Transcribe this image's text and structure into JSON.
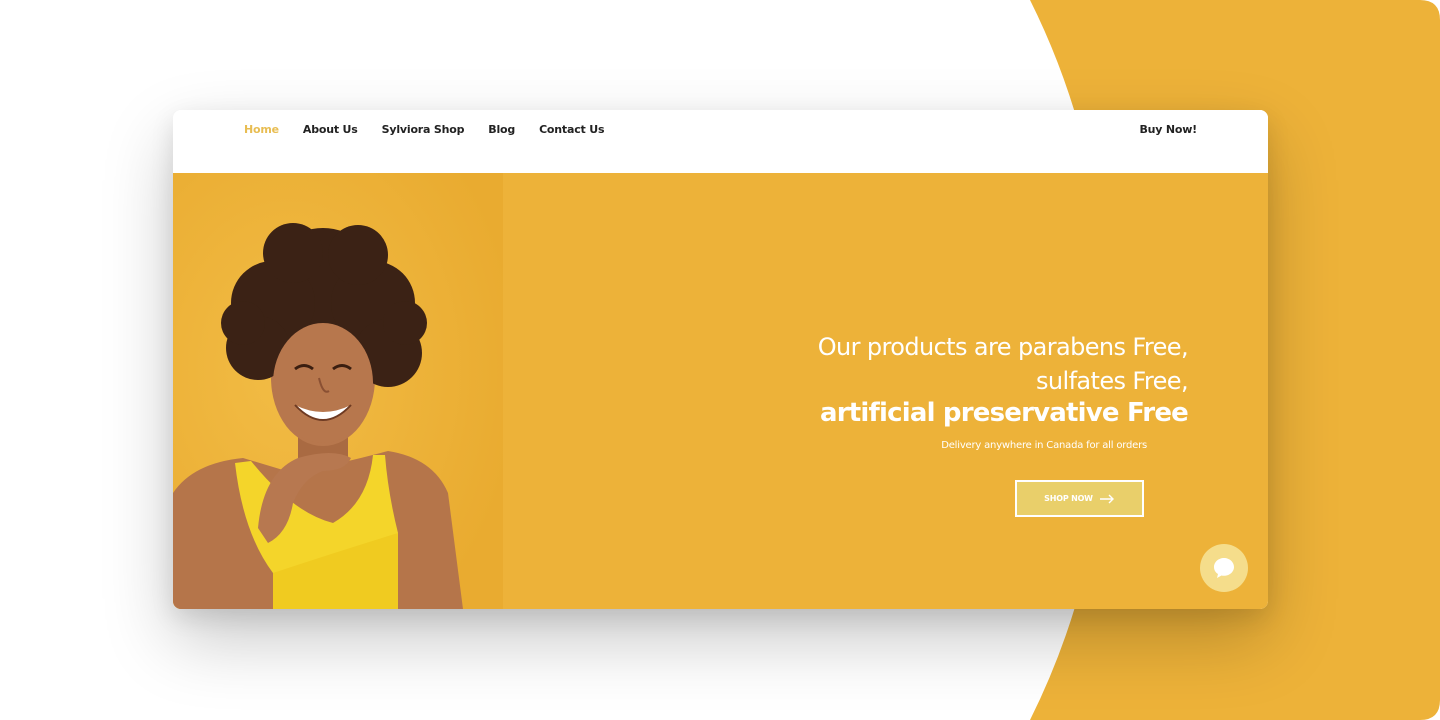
{
  "nav": {
    "items": [
      {
        "label": "Home",
        "active": true
      },
      {
        "label": "About Us",
        "active": false
      },
      {
        "label": "Sylviora Shop",
        "active": false
      },
      {
        "label": "Blog",
        "active": false
      },
      {
        "label": "Contact Us",
        "active": false
      }
    ],
    "buy_now_label": "Buy Now!"
  },
  "hero": {
    "headline_line1": "Our products are parabens Free,",
    "headline_line2": "sulfates Free,",
    "headline_line3": "artificial preservative Free",
    "subline": "Delivery anywhere in Canada for all orders",
    "shop_button_label": "SHOP NOW",
    "shop_button_icon": "arrow-right-icon",
    "photo": "smiling-woman-photo",
    "chat_icon": "chat-bubble-icon"
  },
  "colors": {
    "accent": "#edb239",
    "active_nav": "#e8bd52",
    "button_fill": "#e9cf6a",
    "chat_fill": "#f5dd8b",
    "text_dark": "#222222"
  }
}
